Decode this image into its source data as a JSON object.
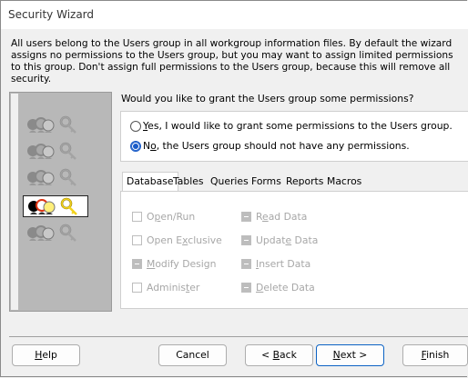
{
  "window": {
    "title": "Security Wizard"
  },
  "intro_text": "All users belong to the Users group in all workgroup information files. By default the wizard assigns no permissions to the Users group, but you may want to assign limited permissions to this group. Don't assign full permissions to the Users group, because this will remove all security.",
  "left_panel": {
    "icons": [
      {
        "name": "users-key-icon",
        "selected": false
      },
      {
        "name": "users-key-icon",
        "selected": false
      },
      {
        "name": "users-key-icon",
        "selected": false
      },
      {
        "name": "users-key-icon",
        "selected": true
      },
      {
        "name": "users-key-icon",
        "selected": false
      }
    ]
  },
  "question": "Would you like to grant the Users group some permissions?",
  "options": {
    "yes": {
      "accel": "Y",
      "rest": "es, I would like to grant some permissions to the Users group.",
      "checked": false
    },
    "no": {
      "accel": "o",
      "pre": "N",
      "rest": ", the Users group should not have any permissions.",
      "checked": true
    }
  },
  "tabs": [
    "Database",
    "Tables",
    "Queries",
    "Forms",
    "Reports",
    "Macros"
  ],
  "active_tab": "Database",
  "permissions": {
    "open_run": {
      "pre": "O",
      "accel": "p",
      "rest": "en/Run"
    },
    "open_exclusive": {
      "pre": "Open E",
      "accel": "x",
      "rest": "clusive"
    },
    "modify_design": {
      "pre": "",
      "accel": "M",
      "rest": "odify Design"
    },
    "administer": {
      "pre": "Adminis",
      "accel": "t",
      "rest": "er"
    },
    "read_data": {
      "pre": "R",
      "accel": "e",
      "rest": "ad Data"
    },
    "update_data": {
      "pre": "Updat",
      "accel": "e",
      "rest": " Data"
    },
    "insert_data": {
      "pre": "",
      "accel": "I",
      "rest": "nsert Data"
    },
    "delete_data": {
      "pre": "",
      "accel": "D",
      "rest": "elete Data"
    }
  },
  "buttons": {
    "help": {
      "accel": "H",
      "rest": "elp"
    },
    "cancel": "Cancel",
    "back": {
      "pre": "< ",
      "accel": "B",
      "rest": "ack"
    },
    "next": {
      "accel": "N",
      "rest": "ext >"
    },
    "finish": {
      "accel": "F",
      "rest": "inish"
    }
  },
  "colors": {
    "accent": "#1a5cc8",
    "disabled_text": "#a7a7a7",
    "panel_grey": "#b8b8b8"
  }
}
